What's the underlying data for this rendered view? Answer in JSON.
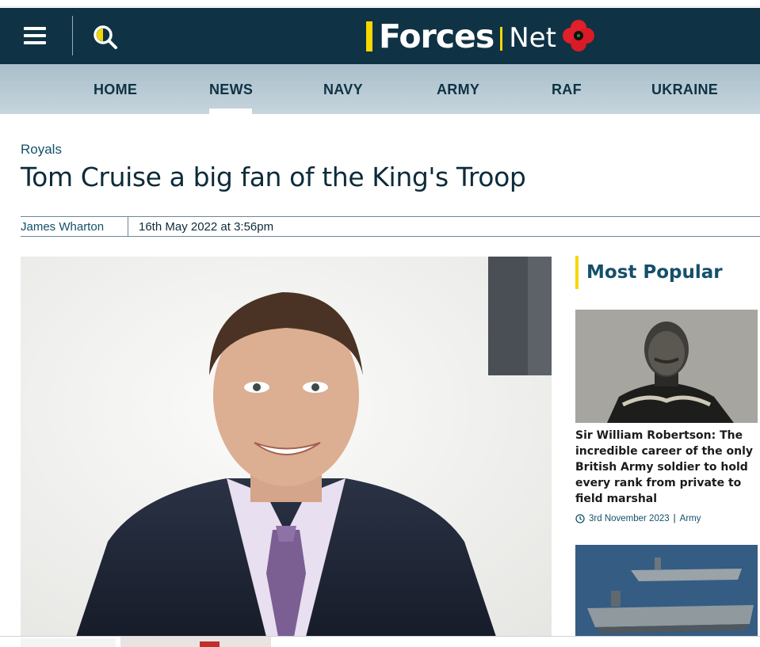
{
  "header": {
    "logo_word": "Forces",
    "logo_suffix": "Net"
  },
  "nav": {
    "items": [
      {
        "label": "HOME"
      },
      {
        "label": "NEWS",
        "active": true
      },
      {
        "label": "NAVY"
      },
      {
        "label": "ARMY"
      },
      {
        "label": "RAF"
      },
      {
        "label": "UKRAINE"
      }
    ]
  },
  "article": {
    "category": "Royals",
    "title": "Tom Cruise a big fan of the King's Troop",
    "author": "James Wharton",
    "date": "16th May 2022 at 3:56pm"
  },
  "sidebar": {
    "title": "Most Popular",
    "cards": [
      {
        "headline": "Sir William Robertson: The incredible career of the only British Army soldier to hold every rank from private to field marshal",
        "date": "3rd November 2023",
        "category": "Army"
      }
    ]
  },
  "icons": {
    "menu": "hamburger-menu-icon",
    "search": "search-icon",
    "poppy": "poppy-icon",
    "clock": "clock-icon"
  },
  "colors": {
    "header_bg": "#0f3344",
    "accent_yellow": "#f5d800",
    "nav_bg": "#b7cad4",
    "link_blue": "#14506b",
    "poppy_red": "#e0202a"
  }
}
